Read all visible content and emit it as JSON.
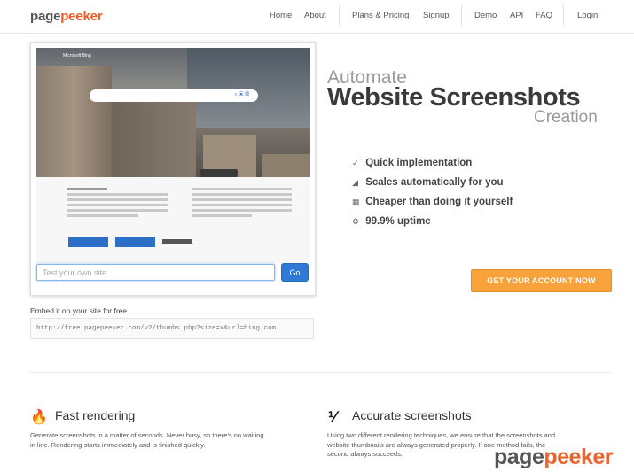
{
  "header": {
    "logo_part1": "page",
    "logo_part2": "peeker",
    "nav": {
      "home": "Home",
      "about": "About",
      "plans": "Plans & Pricing",
      "signup": "Signup",
      "demo": "Demo",
      "api": "API",
      "faq": "FAQ",
      "login": "Login"
    }
  },
  "preview": {
    "site_name": "Microsoft Bing",
    "url_placeholder": "Test your own site",
    "go_label": "Go"
  },
  "embed": {
    "label": "Embed it on your site for free",
    "code": "http://free.pagepeeker.com/v2/thumbs.php?size=x&url=bing.com"
  },
  "hero": {
    "line1": "Automate",
    "line2": "Website Screenshots",
    "line3": "Creation",
    "features": [
      {
        "icon": "pencil-icon",
        "glyph": "✓",
        "text": "Quick implementation"
      },
      {
        "icon": "chart-icon",
        "glyph": "◢",
        "text": "Scales automatically for you"
      },
      {
        "icon": "grid-icon",
        "glyph": "▦",
        "text": "Cheaper than doing it yourself"
      },
      {
        "icon": "gear-icon",
        "glyph": "⚙",
        "text": "99.9% uptime"
      }
    ],
    "cta_label": "GET YOUR ACCOUNT NOW"
  },
  "bottom": {
    "fast": {
      "icon_glyph": "🔥",
      "title": "Fast rendering",
      "desc_line1": "Generate screenshots in a matter of seconds. Never busy, so there's no waiting",
      "desc_line2": "in line. Rendering starts immediately and is finished quickly."
    },
    "accurate": {
      "icon_glyph": "⅟",
      "title": "Accurate screenshots",
      "desc_line1": "Using two different rendering techniques, we ensure that the screenshots and",
      "desc_line2": "website thumbnails are always generated properly. If one method fails, the",
      "desc_line3": "second always succeeds."
    }
  },
  "watermark": {
    "part1": "page",
    "part2": "peeker"
  },
  "colors": {
    "brand_orange": "#f05a28",
    "cta_orange": "#f7a23b",
    "go_blue": "#2f7ad4"
  }
}
